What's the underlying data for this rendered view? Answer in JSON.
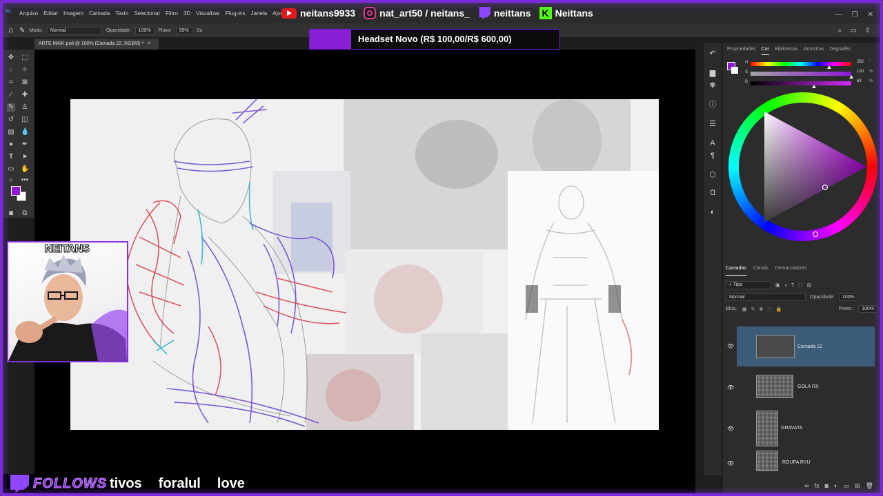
{
  "menubar": {
    "app_icon": "Ps",
    "items": [
      "Arquivo",
      "Editar",
      "Imagem",
      "Camada",
      "Texto",
      "Selecionar",
      "Filtro",
      "3D",
      "Visualizar",
      "Plug-ins",
      "Janela",
      "Ajuda"
    ]
  },
  "socials": {
    "youtube": "neitans9933",
    "instagram": "nat_art50 / neitans_",
    "twitch": "neittans",
    "kick": "Neittans",
    "kick_letter": "K"
  },
  "options": {
    "mode_label": "Modo:",
    "mode_value": "Normal",
    "opacity_label": "Opacidade:",
    "opacity_value": "100%",
    "flow_label": "Fluxo:",
    "flow_value": "55%",
    "smooth_label": "Su"
  },
  "banner": {
    "text": "Headset Novo (R$ 100,00/R$ 600,00)"
  },
  "document": {
    "tab_title": "ARTE MAIK.psd @ 100% (Camada 22, RGB/8) *",
    "close": "×"
  },
  "webcam": {
    "logo": "NEITANS"
  },
  "ticker": {
    "follows": "FOLLOWS",
    "names": [
      "tivos",
      "foralul",
      "love"
    ]
  },
  "panels": {
    "tabs": [
      "Propriedades",
      "Cor",
      "Bibliotecas",
      "Amostras",
      "Degradês"
    ],
    "active_tab": "Cor",
    "color": {
      "hsb": [
        {
          "label": "H",
          "value": "282",
          "unit": "°",
          "fraction": 0.78
        },
        {
          "label": "S",
          "value": "100",
          "unit": "%",
          "fraction": 1.0
        },
        {
          "label": "B",
          "value": "63",
          "unit": "%",
          "fraction": 0.63
        }
      ],
      "foreground": "#8e18d8",
      "background": "#ffffff"
    },
    "layers_tabs": [
      "Camadas",
      "Canais",
      "Demarcadores"
    ],
    "active_layers_tab": "Camadas",
    "filter_label": "Tipo",
    "blend_mode": "Normal",
    "opacity_label": "Opacidade:",
    "opacity_value": "100%",
    "lock_label": "Bloq.:",
    "fill_label": "Preen.:",
    "fill_value": "100%",
    "layers": [
      {
        "name": "Camada 22",
        "selected": true
      },
      {
        "name": "GOLA RX",
        "selected": false
      },
      {
        "name": "GRAVATA",
        "selected": false
      },
      {
        "name": "ROUPA RYU",
        "selected": false
      }
    ]
  }
}
